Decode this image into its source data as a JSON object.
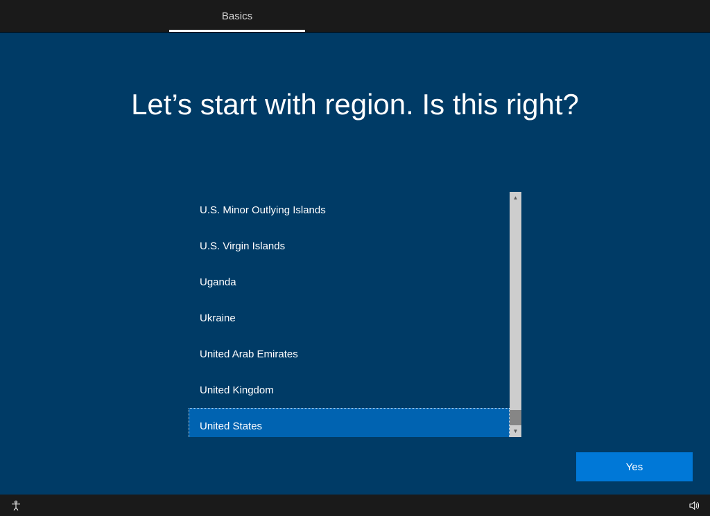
{
  "tabbar": {
    "tabs": [
      {
        "label": "Basics",
        "active": true
      }
    ]
  },
  "heading": "Let’s start with region. Is this right?",
  "regions": {
    "items": [
      "U.S. Minor Outlying Islands",
      "U.S. Virgin Islands",
      "Uganda",
      "Ukraine",
      "United Arab Emirates",
      "United Kingdom",
      "United States"
    ],
    "selected_index": 6
  },
  "primary_button": {
    "label": "Yes"
  },
  "colors": {
    "page_bg": "#003b66",
    "tabbar_bg": "#1a1a1a",
    "accent": "#0078d7",
    "selected_bg": "#0063b1"
  }
}
